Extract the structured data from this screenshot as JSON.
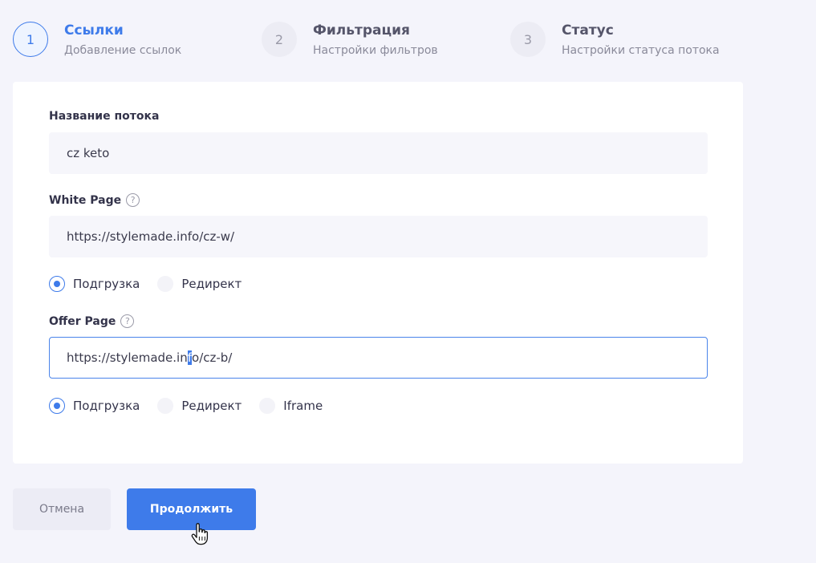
{
  "steps": [
    {
      "number": "1",
      "title": "Ссылки",
      "subtitle": "Добавление ссылок",
      "active": true
    },
    {
      "number": "2",
      "title": "Фильтрация",
      "subtitle": "Настройки фильтров",
      "active": false
    },
    {
      "number": "3",
      "title": "Статус",
      "subtitle": "Настройки статуса потока",
      "active": false
    }
  ],
  "form": {
    "stream_name": {
      "label": "Название потока",
      "value": "cz keto"
    },
    "white_page": {
      "label": "White Page",
      "value": "https://stylemade.info/cz-w/",
      "options": [
        "Подгрузка",
        "Редирект"
      ],
      "selected": "Подгрузка"
    },
    "offer_page": {
      "label": "Offer Page",
      "value_before_caret": "https://stylemade.in",
      "value_caret_char": "f",
      "value_after_caret": "o/cz-b/",
      "options": [
        "Подгрузка",
        "Редирект",
        "Iframe"
      ],
      "selected": "Подгрузка"
    }
  },
  "buttons": {
    "cancel": "Отмена",
    "continue": "Продолжить"
  },
  "icons": {
    "help": "question-circle-icon",
    "cursor": "hand-pointer-icon"
  },
  "colors": {
    "accent": "#3e7bea",
    "background": "#f4f4fb"
  }
}
